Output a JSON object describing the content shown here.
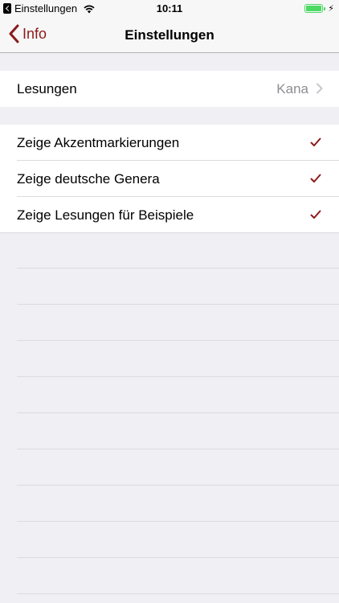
{
  "status_bar": {
    "back_app": "Einstellungen",
    "time": "10:11",
    "icons": [
      "back-app-icon",
      "wifi-icon",
      "battery-icon",
      "bolt-icon"
    ],
    "battery_percent": 100
  },
  "nav": {
    "back_label": "Info",
    "title": "Einstellungen"
  },
  "reading_section": {
    "label": "Lesungen",
    "value": "Kana"
  },
  "options": [
    {
      "label": "Zeige Akzentmarkierungen",
      "checked": true
    },
    {
      "label": "Zeige deutsche Genera",
      "checked": true
    },
    {
      "label": "Zeige Lesungen für Beispiele",
      "checked": true
    }
  ],
  "colors": {
    "accent": "#8b1a1a",
    "background": "#efeff4",
    "battery": "#4cd964",
    "secondary_text": "#8e8e93"
  }
}
